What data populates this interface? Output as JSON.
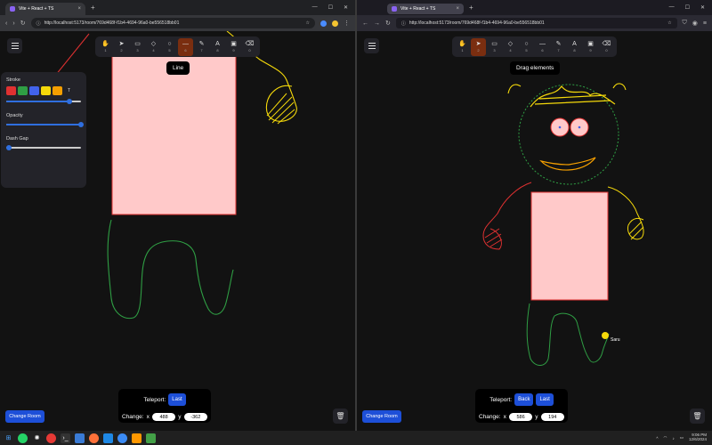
{
  "left_window": {
    "tab_title": "Vite + React + TS",
    "url": "http://localhost:5173/room/769d468f-f1b4-4694-96a0-be556518bb01",
    "tooltip": "Line",
    "tools": [
      "✋",
      "➤",
      "▭",
      "◇",
      "○",
      "—",
      "✎",
      "A",
      "▣",
      "⌫"
    ],
    "tool_numbers": [
      "1",
      "2",
      "3",
      "4",
      "5",
      "6",
      "7",
      "8",
      "9",
      "0"
    ],
    "active_tool_index": 5,
    "props": {
      "stroke_label": "Stroke",
      "stroke_colors": [
        "#e03131",
        "#2f9e44",
        "#4263eb",
        "#f5d90a",
        "#f59f00"
      ],
      "stroke_extra": "T",
      "stroke_width": 0.85,
      "opacity_label": "Opacity",
      "opacity_value": 1.0,
      "dash_label": "Dash Gap",
      "dash_value": 0.0
    },
    "teleport": {
      "label": "Teleport:",
      "buttons": [
        "Last"
      ],
      "change_label": "Change:",
      "x_label": "x",
      "x_value": "488",
      "y_label": "y",
      "y_value": "-362"
    },
    "change_room": "Change Room"
  },
  "right_window": {
    "tab_title": "Vite + React + TS",
    "url": "http://localhost:5173/room/769d468f-f1b4-4694-96a0-be556518bb01",
    "tooltip": "Drag elements",
    "tools": [
      "✋",
      "➤",
      "▭",
      "◇",
      "○",
      "—",
      "✎",
      "A",
      "▣",
      "⌫"
    ],
    "tool_numbers": [
      "1",
      "2",
      "3",
      "4",
      "5",
      "6",
      "7",
      "8",
      "9",
      "0"
    ],
    "active_tool_index": 1,
    "cursor_user": "Saru",
    "teleport": {
      "label": "Teleport:",
      "buttons": [
        "Back",
        "Last"
      ],
      "change_label": "Change:",
      "x_label": "x",
      "x_value": "586",
      "y_label": "y",
      "y_value": "194"
    },
    "change_room": "Change Room"
  },
  "taskbar": {
    "time": "9:06 PM",
    "date": "12/6/2024"
  },
  "colors": {
    "accent_blue": "#1d4fd8",
    "active_tool": "#7a2e10",
    "rect_fill": "#ffc9c9",
    "rect_stroke": "#e03131"
  }
}
